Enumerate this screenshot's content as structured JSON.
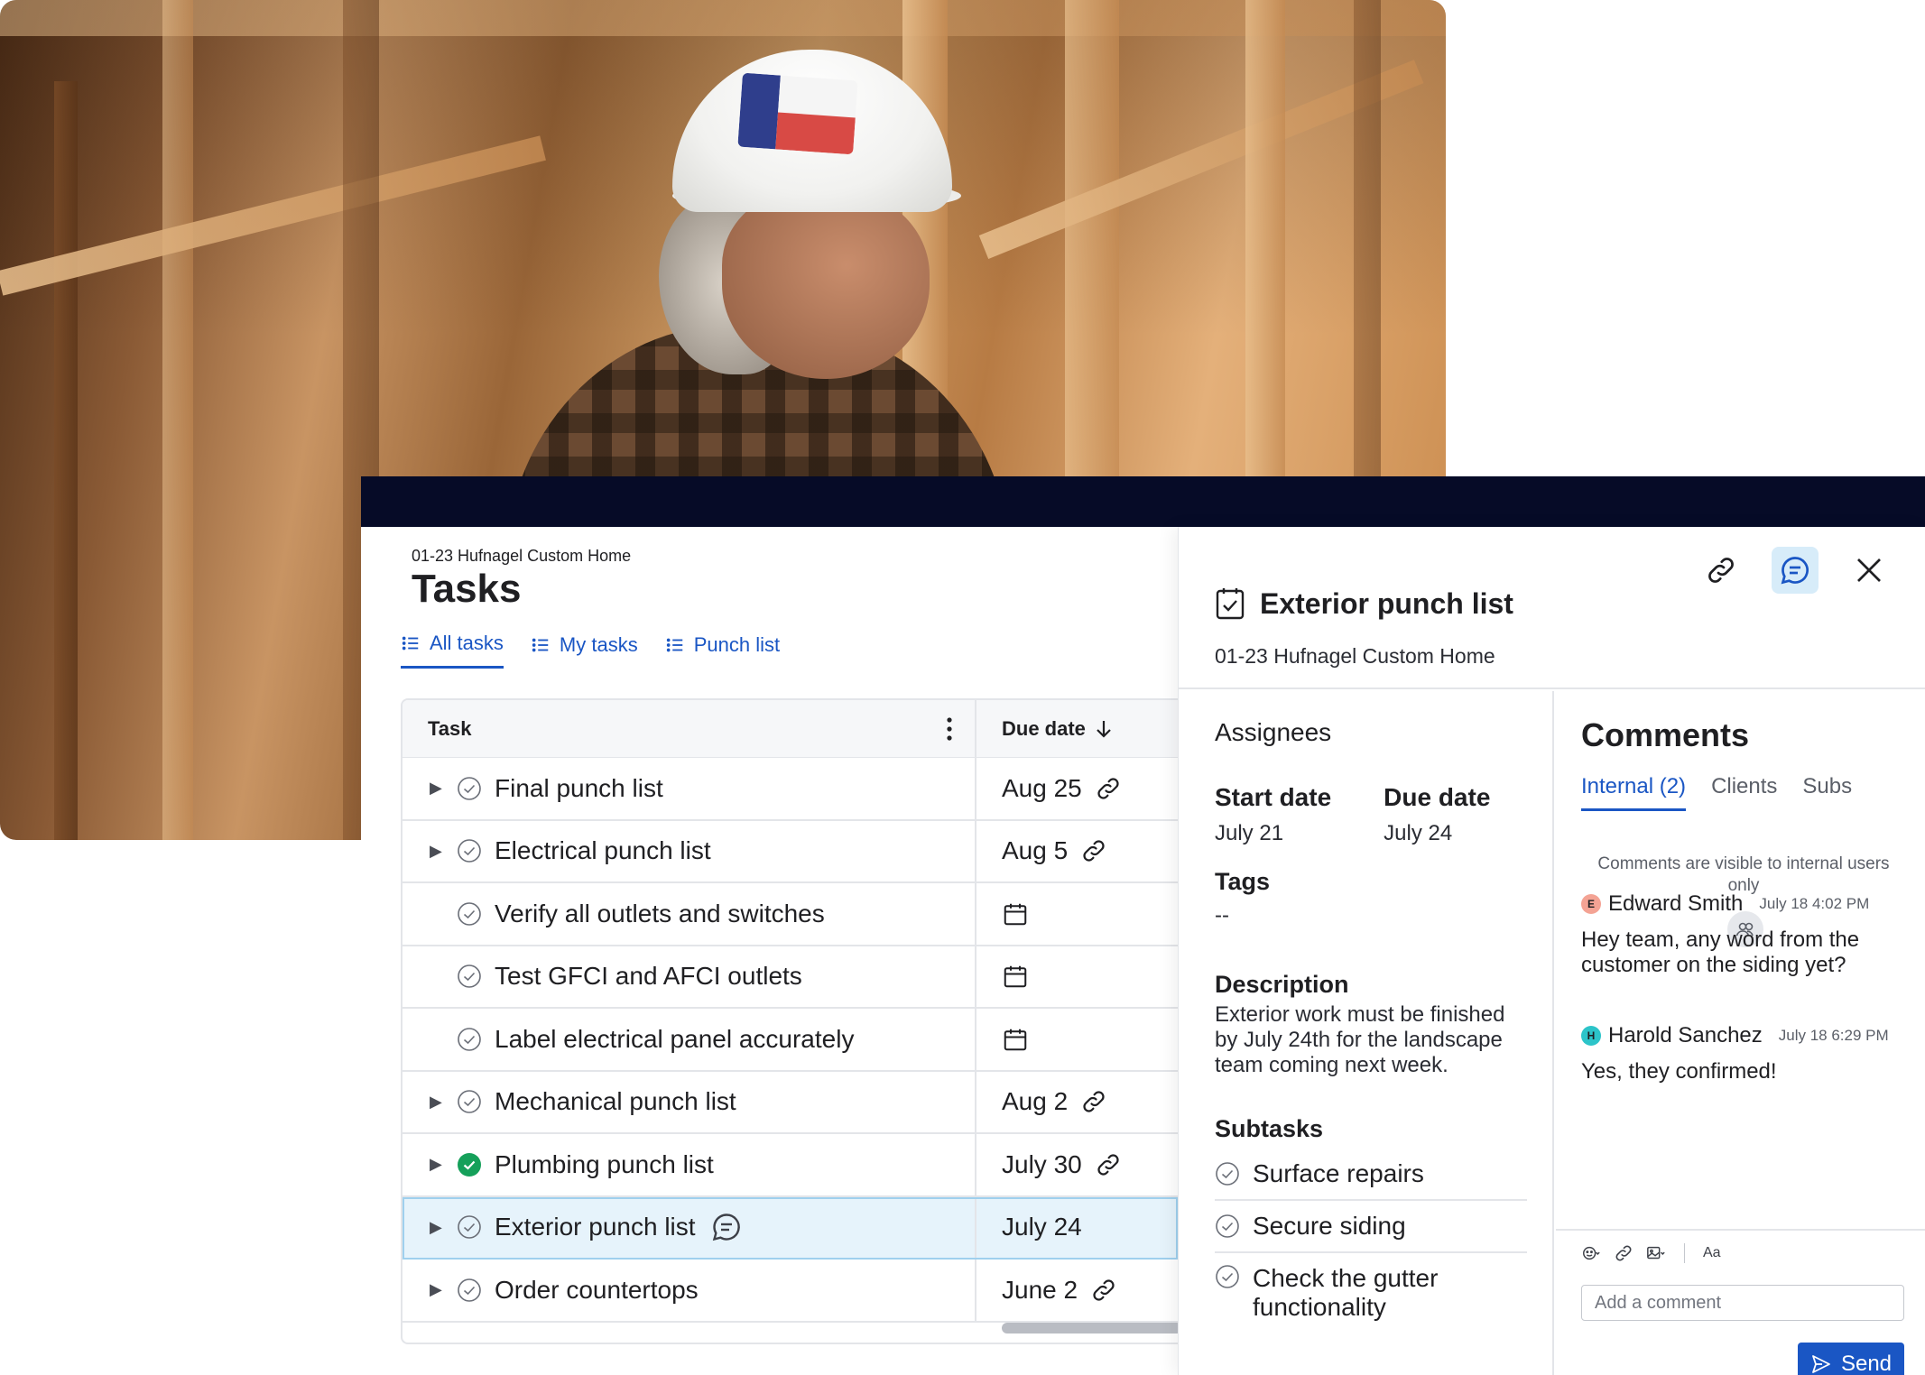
{
  "main": {
    "breadcrumb": "01-23 Hufnagel Custom Home",
    "title": "Tasks",
    "tabs": [
      {
        "label": "All tasks"
      },
      {
        "label": "My tasks"
      },
      {
        "label": "Punch list"
      }
    ],
    "table": {
      "col_task": "Task",
      "col_due": "Due date",
      "rows": [
        {
          "task": "Final punch list",
          "due": "Aug 25",
          "complete": false,
          "has_children": true
        },
        {
          "task": "Electrical punch list",
          "due": "Aug 5",
          "complete": false,
          "has_children": true
        },
        {
          "task": "Verify all outlets and switches",
          "due": "",
          "complete": false,
          "has_children": false
        },
        {
          "task": "Test GFCI and AFCI outlets",
          "due": "",
          "complete": false,
          "has_children": false
        },
        {
          "task": "Label electrical panel accurately",
          "due": "",
          "complete": false,
          "has_children": false
        },
        {
          "task": "Mechanical punch list",
          "due": "Aug 2",
          "complete": false,
          "has_children": true
        },
        {
          "task": "Plumbing punch list",
          "due": "July 30",
          "complete": true,
          "has_children": true
        },
        {
          "task": "Exterior punch list",
          "due": "July 24",
          "complete": false,
          "has_children": true,
          "selected": true
        },
        {
          "task": "Order countertops",
          "due": "June 2",
          "complete": false,
          "has_children": true
        }
      ]
    }
  },
  "panel": {
    "title": "Exterior punch list",
    "subtitle": "01-23 Hufnagel Custom Home",
    "assignees_label": "Assignees",
    "start_label": "Start date",
    "start_value": "July 21",
    "due_label": "Due date",
    "due_value": "July 24",
    "tags_label": "Tags",
    "tags_value": "--",
    "description_label": "Description",
    "description_value": "Exterior work must be finished by July 24th for the landscape team coming next week.",
    "subtasks_label": "Subtasks",
    "subtasks": [
      "Surface repairs",
      "Secure siding",
      "Check the gutter functionality"
    ]
  },
  "comments": {
    "title": "Comments",
    "tabs": [
      {
        "label": "Internal (2)"
      },
      {
        "label": "Clients"
      },
      {
        "label": "Subs"
      }
    ],
    "visibility_note": "Comments are visible to internal users only",
    "items": [
      {
        "initial": "E",
        "author": "Edward Smith",
        "time": "July 18 4:02 PM",
        "body": "Hey team, any word from the customer on the siding yet?",
        "avatar_color": "#f4a394"
      },
      {
        "initial": "H",
        "author": "Harold Sanchez",
        "time": "July 18 6:29 PM",
        "body": "Yes, they confirmed!",
        "avatar_color": "#2cc4c9"
      }
    ],
    "toolbar_text": "Aa",
    "input_placeholder": "Add a comment",
    "send_label": "Send"
  },
  "colors": {
    "accent": "#1a56c4",
    "topbar": "#060b27",
    "complete": "#15a05a",
    "selected_row": "#e6f3fb"
  }
}
